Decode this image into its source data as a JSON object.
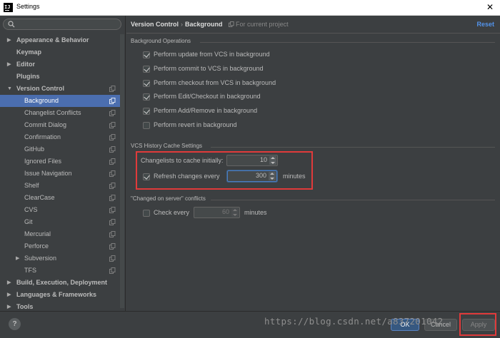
{
  "window": {
    "title": "Settings",
    "app_icon_text": "IJ",
    "close_glyph": "✕"
  },
  "search": {
    "placeholder": "",
    "value": ""
  },
  "sidebar": {
    "items": [
      {
        "label": "Appearance & Behavior",
        "arrow": "▶",
        "bold": true,
        "indent": 0,
        "copy": false,
        "selected": false
      },
      {
        "label": "Keymap",
        "arrow": "",
        "bold": true,
        "indent": 0,
        "copy": false,
        "selected": false
      },
      {
        "label": "Editor",
        "arrow": "▶",
        "bold": true,
        "indent": 0,
        "copy": false,
        "selected": false
      },
      {
        "label": "Plugins",
        "arrow": "",
        "bold": true,
        "indent": 0,
        "copy": false,
        "selected": false
      },
      {
        "label": "Version Control",
        "arrow": "▼",
        "bold": true,
        "indent": 0,
        "copy": true,
        "selected": false
      },
      {
        "label": "Background",
        "arrow": "",
        "bold": false,
        "indent": 1,
        "copy": true,
        "selected": true
      },
      {
        "label": "Changelist Conflicts",
        "arrow": "",
        "bold": false,
        "indent": 1,
        "copy": true,
        "selected": false
      },
      {
        "label": "Commit Dialog",
        "arrow": "",
        "bold": false,
        "indent": 1,
        "copy": true,
        "selected": false
      },
      {
        "label": "Confirmation",
        "arrow": "",
        "bold": false,
        "indent": 1,
        "copy": true,
        "selected": false
      },
      {
        "label": "GitHub",
        "arrow": "",
        "bold": false,
        "indent": 1,
        "copy": true,
        "selected": false
      },
      {
        "label": "Ignored Files",
        "arrow": "",
        "bold": false,
        "indent": 1,
        "copy": true,
        "selected": false
      },
      {
        "label": "Issue Navigation",
        "arrow": "",
        "bold": false,
        "indent": 1,
        "copy": true,
        "selected": false
      },
      {
        "label": "Shelf",
        "arrow": "",
        "bold": false,
        "indent": 1,
        "copy": true,
        "selected": false
      },
      {
        "label": "ClearCase",
        "arrow": "",
        "bold": false,
        "indent": 1,
        "copy": true,
        "selected": false
      },
      {
        "label": "CVS",
        "arrow": "",
        "bold": false,
        "indent": 1,
        "copy": true,
        "selected": false
      },
      {
        "label": "Git",
        "arrow": "",
        "bold": false,
        "indent": 1,
        "copy": true,
        "selected": false
      },
      {
        "label": "Mercurial",
        "arrow": "",
        "bold": false,
        "indent": 1,
        "copy": true,
        "selected": false
      },
      {
        "label": "Perforce",
        "arrow": "",
        "bold": false,
        "indent": 1,
        "copy": true,
        "selected": false
      },
      {
        "label": "Subversion",
        "arrow": "▶",
        "bold": false,
        "indent": 1,
        "copy": true,
        "selected": false
      },
      {
        "label": "TFS",
        "arrow": "",
        "bold": false,
        "indent": 1,
        "copy": true,
        "selected": false
      },
      {
        "label": "Build, Execution, Deployment",
        "arrow": "▶",
        "bold": true,
        "indent": 0,
        "copy": false,
        "selected": false
      },
      {
        "label": "Languages & Frameworks",
        "arrow": "▶",
        "bold": true,
        "indent": 0,
        "copy": false,
        "selected": false
      },
      {
        "label": "Tools",
        "arrow": "▶",
        "bold": true,
        "indent": 0,
        "copy": false,
        "selected": false
      }
    ]
  },
  "breadcrumb": {
    "parent": "Version Control",
    "separator": "›",
    "current": "Background",
    "note_icon": "copy-icon",
    "note": "For current project"
  },
  "reset_label": "Reset",
  "background_operations": {
    "title": "Background Operations",
    "options": [
      {
        "label": "Perform update from VCS in background",
        "checked": true
      },
      {
        "label": "Perform commit to VCS in background",
        "checked": true
      },
      {
        "label": "Perform checkout from VCS in background",
        "checked": true
      },
      {
        "label": "Perform Edit/Checkout in background",
        "checked": true
      },
      {
        "label": "Perform Add/Remove in background",
        "checked": true
      },
      {
        "label": "Perform revert in background",
        "checked": false
      }
    ]
  },
  "cache_settings": {
    "title": "VCS History Cache Settings",
    "changelists_label": "Changelists to cache initially:",
    "changelists_value": "10",
    "refresh_label": "Refresh changes every",
    "refresh_checked": true,
    "refresh_value": "300",
    "refresh_unit": "minutes"
  },
  "server_conflicts": {
    "title": "\"Changed on server\" conflicts",
    "check_label": "Check every",
    "check_checked": false,
    "check_value": "60",
    "check_unit": "minutes"
  },
  "buttons": {
    "help": "?",
    "ok": "OK",
    "cancel": "Cancel",
    "apply": "Apply"
  },
  "watermark": "https://blog.csdn.net/a837201042",
  "colors": {
    "accent": "#4b6eaf",
    "highlight": "#e03a3a",
    "link": "#5394ec",
    "background": "#3c3f41"
  }
}
